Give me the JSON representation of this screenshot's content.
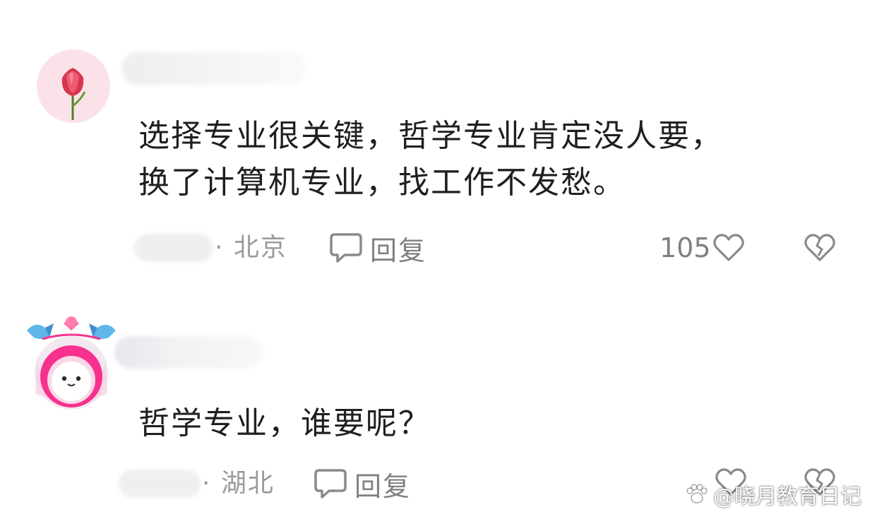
{
  "comments": [
    {
      "text": "选择专业很关键，哲学专业肯定没人要，\n换了计算机专业，找工作不发愁。",
      "location": "· 北京",
      "reply_label": "回复",
      "like_count": "105"
    },
    {
      "text": "哲学专业，谁要呢？",
      "location": "· 湖北",
      "reply_label": "回复",
      "like_count": ""
    }
  ],
  "watermark": {
    "text": "@晓月教育日记",
    "icon": "paw-logo-icon"
  },
  "colors": {
    "text": "#1f1f1f",
    "meta": "#9a9a9a",
    "icon_stroke": "#8a8a8a"
  }
}
